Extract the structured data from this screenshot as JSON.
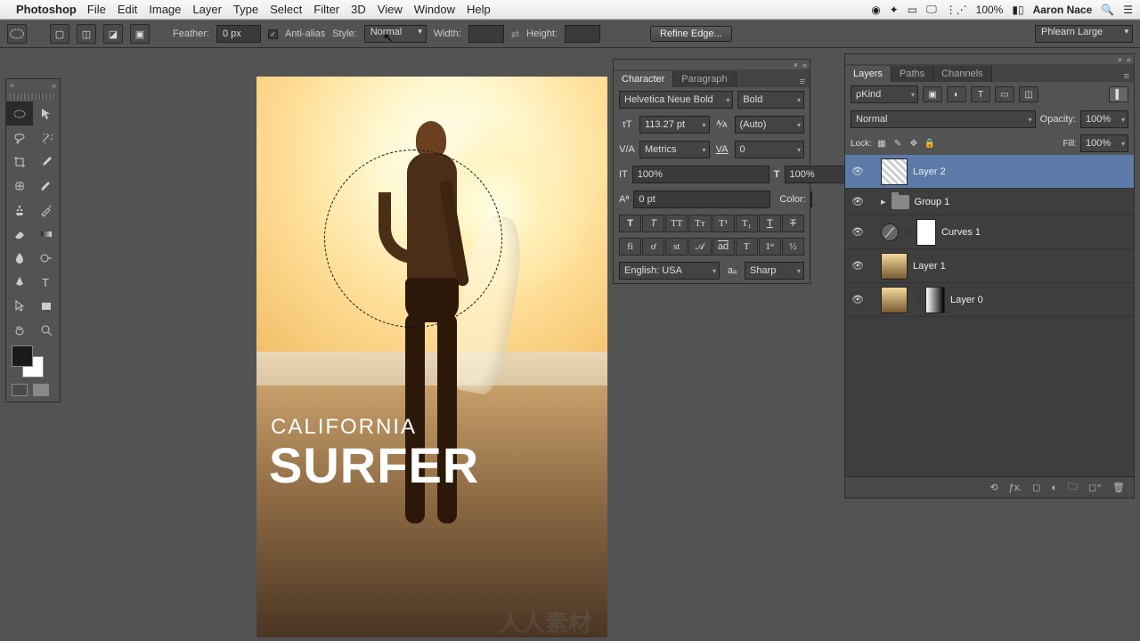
{
  "menubar": {
    "app": "Photoshop",
    "items": [
      "File",
      "Edit",
      "Image",
      "Layer",
      "Type",
      "Select",
      "Filter",
      "3D",
      "View",
      "Window",
      "Help"
    ],
    "battery": "100%",
    "user": "Aaron Nace"
  },
  "optbar": {
    "feather_label": "Feather:",
    "feather_value": "0 px",
    "antialias_label": "Anti-alias",
    "style_label": "Style:",
    "style_value": "Normal",
    "width_label": "Width:",
    "height_label": "Height:",
    "refine_btn": "Refine Edge...",
    "doc_preset": "Phlearn Large"
  },
  "canvas": {
    "text1": "CALIFORNIA",
    "text2": "SURFER"
  },
  "char": {
    "tab_char": "Character",
    "tab_para": "Paragraph",
    "font": "Helvetica Neue Bold",
    "weight": "Bold",
    "size": "113.27 pt",
    "leading": "(Auto)",
    "kerning": "Metrics",
    "tracking": "0",
    "vscale": "100%",
    "hscale": "100%",
    "baseline": "0 pt",
    "color_label": "Color:",
    "lang": "English: USA",
    "aa": "Sharp"
  },
  "layers": {
    "tab_layers": "Layers",
    "tab_paths": "Paths",
    "tab_channels": "Channels",
    "kind": "Kind",
    "blend": "Normal",
    "opacity_label": "Opacity:",
    "opacity": "100%",
    "lock_label": "Lock:",
    "fill_label": "Fill:",
    "fill": "100%",
    "items": [
      {
        "name": "Layer 2"
      },
      {
        "name": "Group 1"
      },
      {
        "name": "Curves 1"
      },
      {
        "name": "Layer 1"
      },
      {
        "name": "Layer 0"
      }
    ]
  }
}
